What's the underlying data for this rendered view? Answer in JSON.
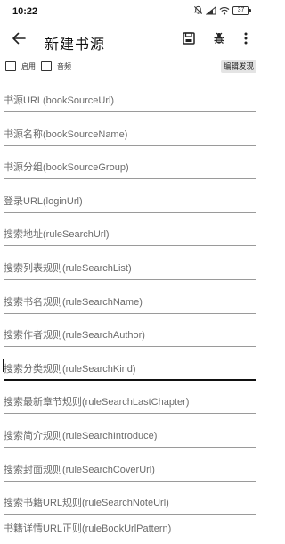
{
  "status_bar": {
    "time": "10:22",
    "battery_level": "37",
    "icons": [
      "mute-icon",
      "signal-icon",
      "wifi-icon",
      "battery-icon"
    ]
  },
  "toolbar": {
    "title": "新建书源",
    "icons": [
      "back-arrow-icon",
      "save-icon",
      "bug-icon",
      "more-vert-icon"
    ]
  },
  "options": {
    "enable_label": "启用",
    "audio_label": "音频",
    "enable_checked": false,
    "audio_checked": false,
    "edit_discover_label": "编辑发现"
  },
  "fields": [
    "书源URL(bookSourceUrl)",
    "书源名称(bookSourceName)",
    "书源分组(bookSourceGroup)",
    "登录URL(loginUrl)",
    "搜索地址(ruleSearchUrl)",
    "搜索列表规则(ruleSearchList)",
    "搜索书名规则(ruleSearchName)",
    "搜索作者规则(ruleSearchAuthor)",
    "搜索分类规则(ruleSearchKind)",
    "搜索最新章节规则(ruleSearchLastChapter)",
    "搜索简介规则(ruleSearchIntroduce)",
    "搜索封面规则(ruleSearchCoverUrl)",
    "搜索书籍URL规则(ruleSearchNoteUrl)",
    "书籍详情URL正则(ruleBookUrlPattern)"
  ],
  "focused_field_index": 8
}
